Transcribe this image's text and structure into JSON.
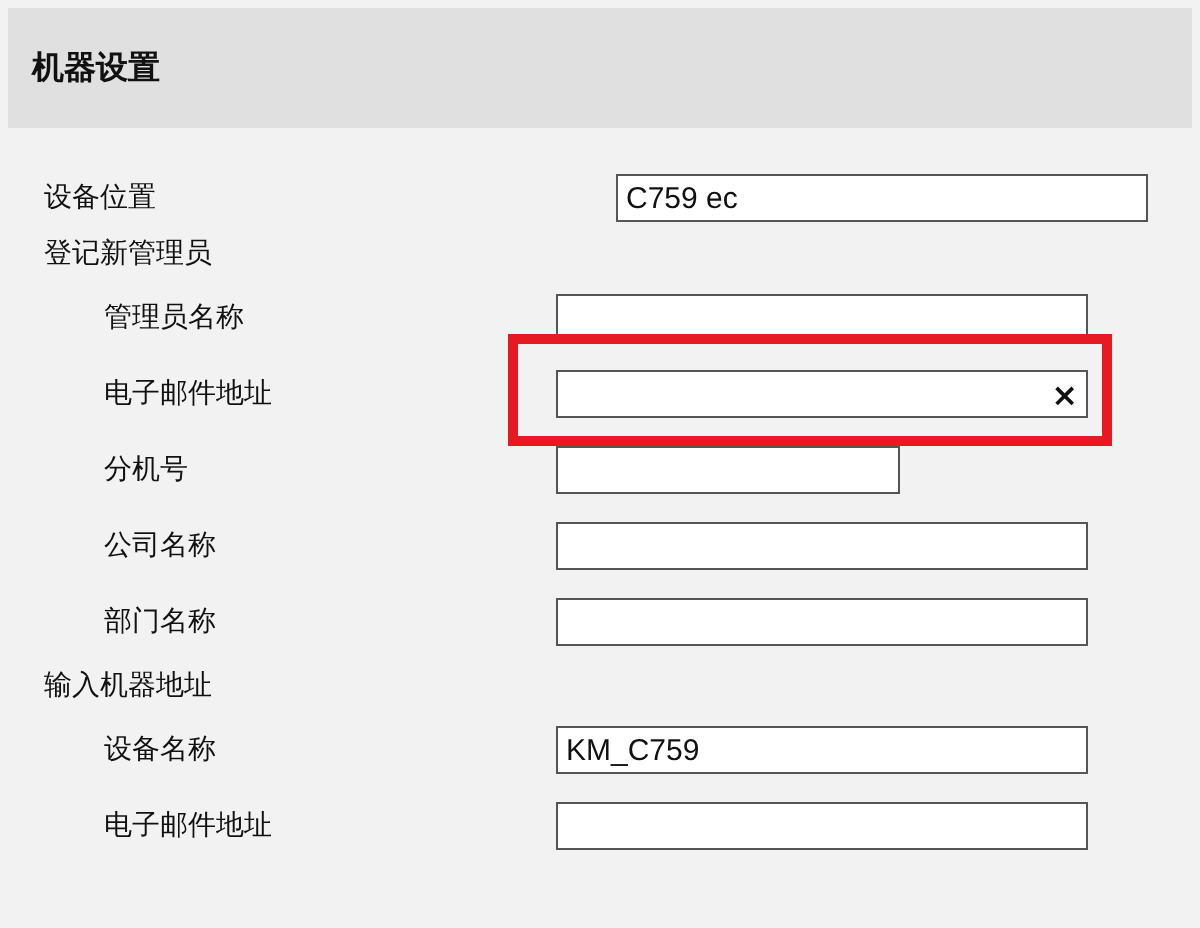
{
  "panel": {
    "title": "机器设置"
  },
  "rows": [
    {
      "kind": "field",
      "label": "设备位置",
      "value": "C759 ec"
    },
    {
      "kind": "section",
      "label": "登记新管理员",
      "children": [
        {
          "kind": "field",
          "label": "管理员名称"
        },
        {
          "kind": "field",
          "label": "电子邮件地址",
          "clear": "×",
          "highlighted": true
        },
        {
          "kind": "short-field",
          "label": "分机号"
        },
        {
          "kind": "field",
          "label": "公司名称"
        },
        {
          "kind": "field",
          "label": "部门名称"
        }
      ]
    },
    {
      "kind": "section",
      "label": "输入机器地址",
      "children": [
        {
          "kind": "field",
          "label": "设备名称",
          "value": "KM_C759"
        },
        {
          "kind": "field",
          "label": "电子邮件地址"
        }
      ]
    }
  ]
}
